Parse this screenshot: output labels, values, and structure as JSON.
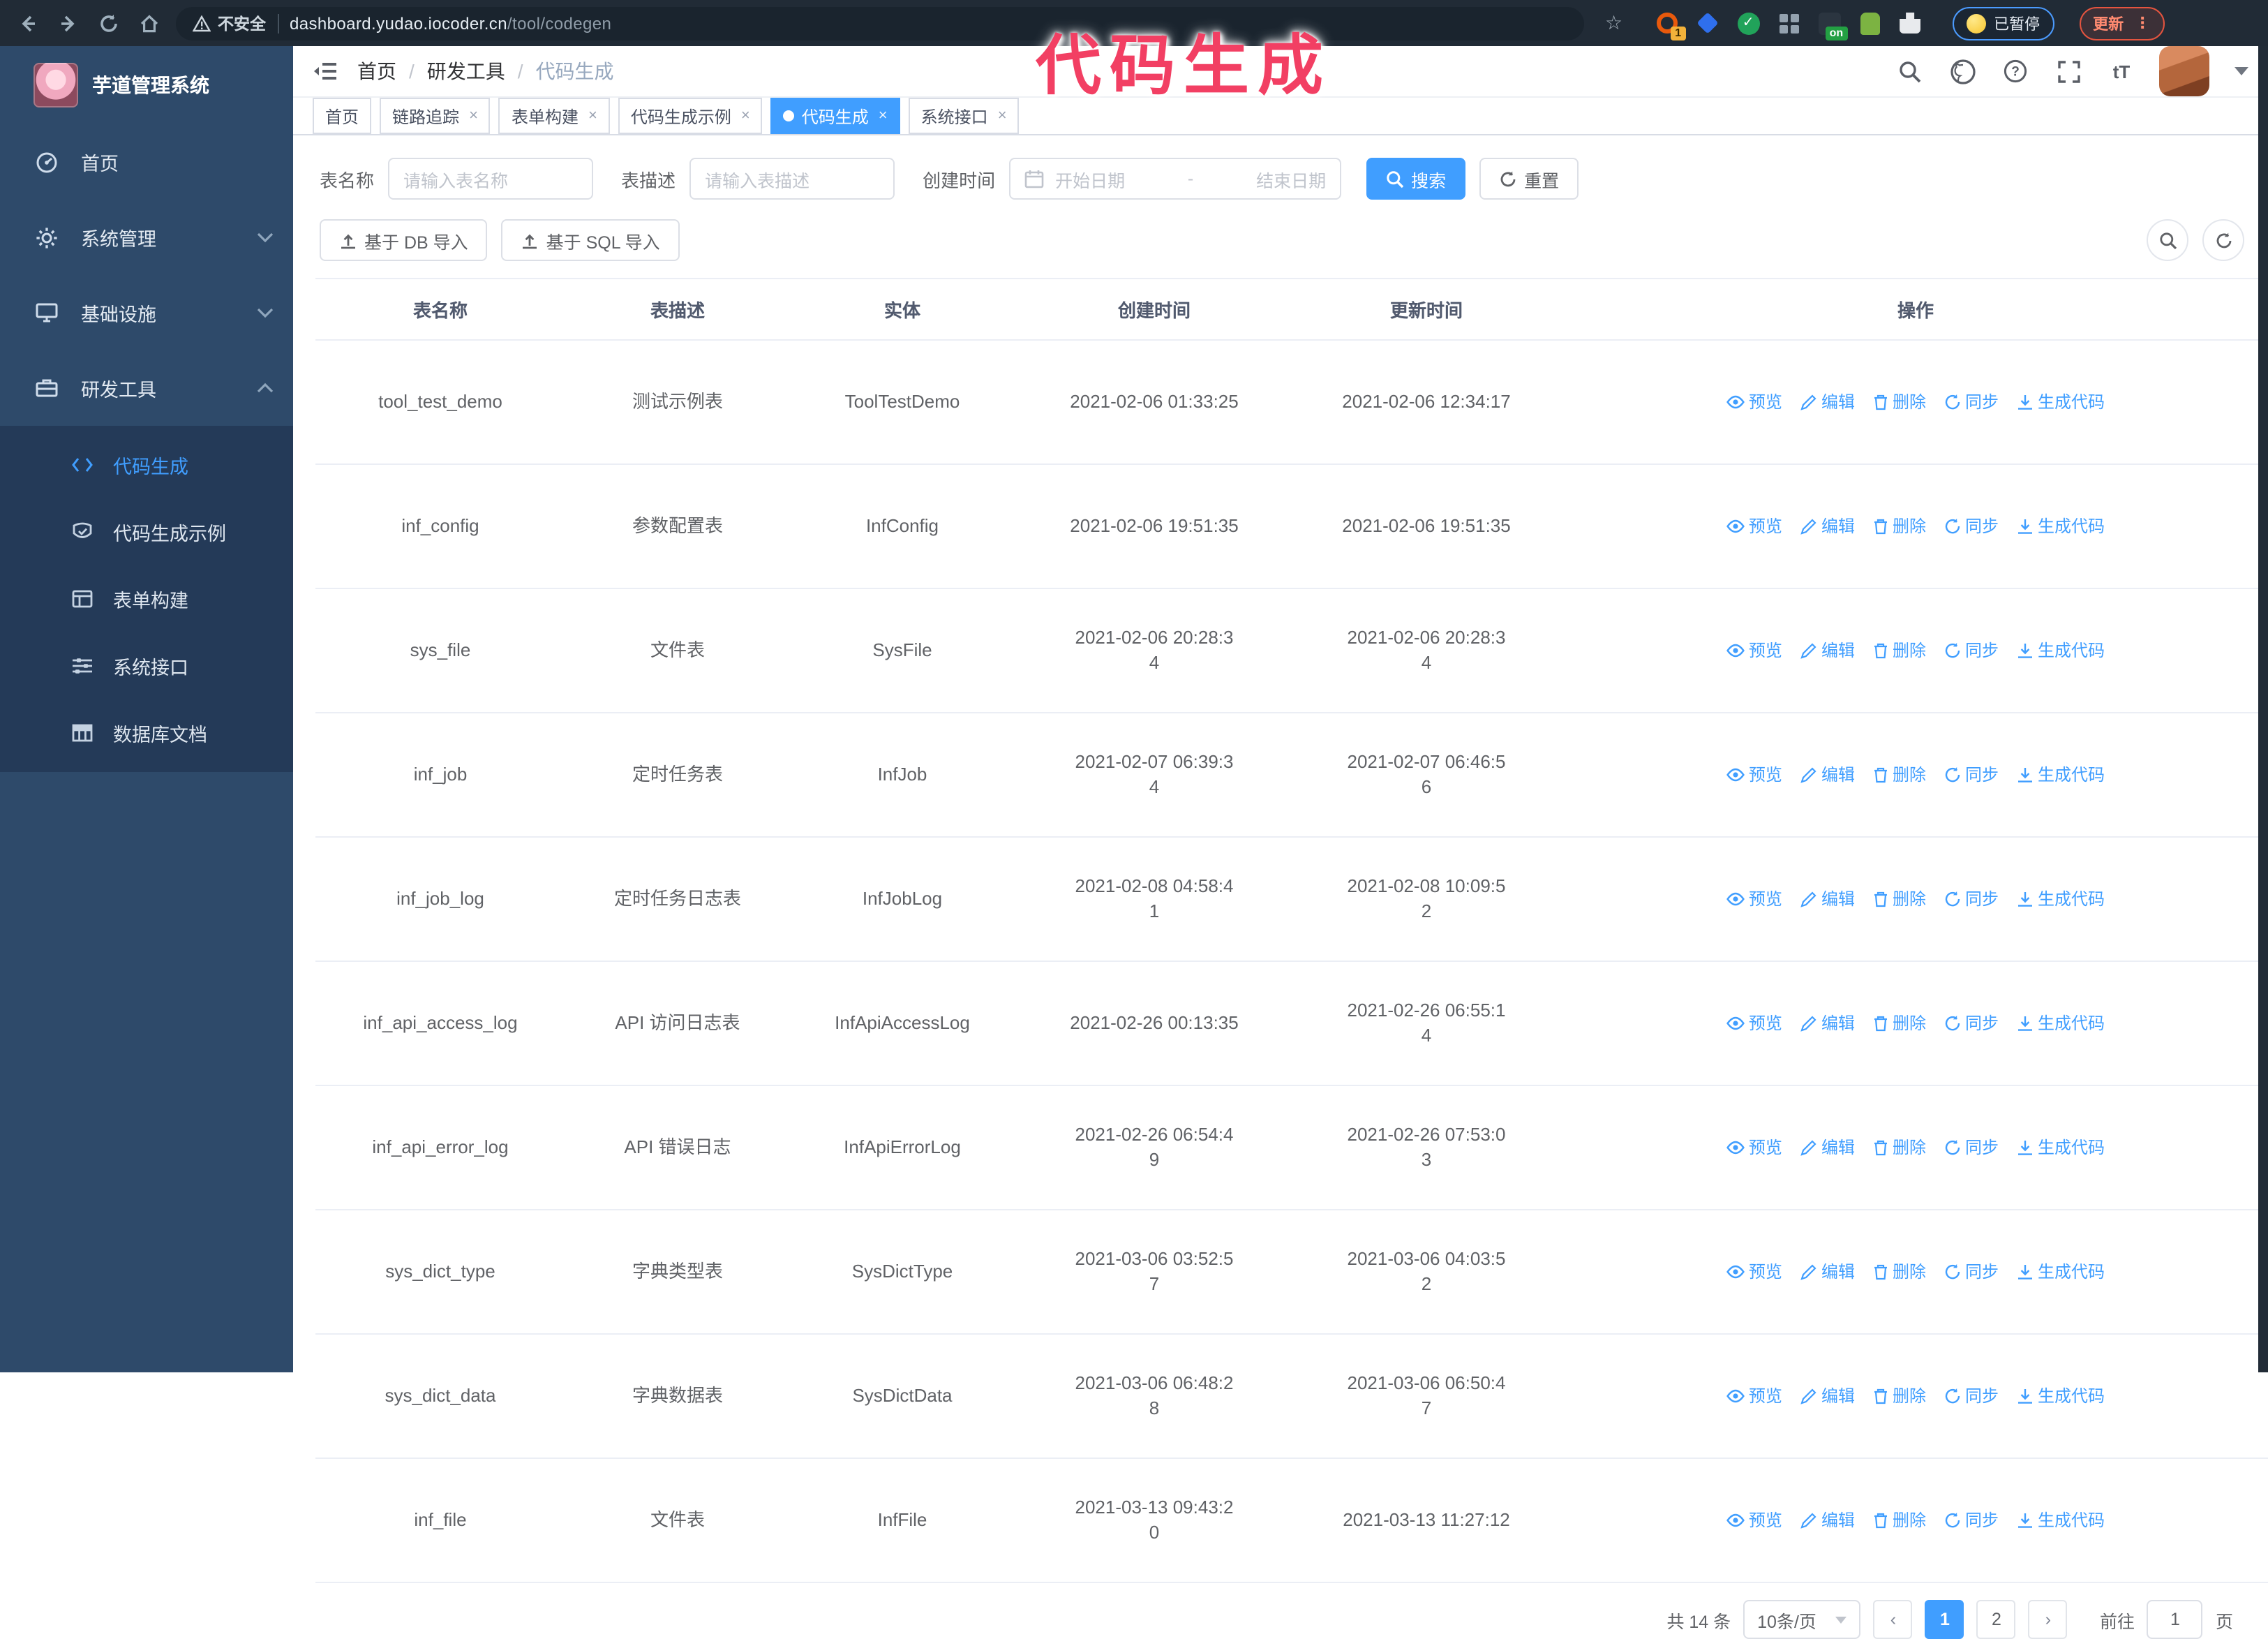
{
  "browser": {
    "security_warning": "不安全",
    "url_host": "dashboard.yudao.iocoder.cn",
    "url_path": "/tool/codegen",
    "extension_badge": "1",
    "extension_on_badge": "on",
    "paused_badge": "已暂停",
    "update_button": "更新"
  },
  "annotation": {
    "text": "代码生成"
  },
  "sidebar": {
    "title": "芋道管理系统",
    "items": [
      {
        "label": "首页"
      },
      {
        "label": "系统管理"
      },
      {
        "label": "基础设施"
      },
      {
        "label": "研发工具"
      }
    ],
    "submenu": [
      {
        "label": "代码生成"
      },
      {
        "label": "代码生成示例"
      },
      {
        "label": "表单构建"
      },
      {
        "label": "系统接口"
      },
      {
        "label": "数据库文档"
      }
    ]
  },
  "navbar": {
    "breadcrumb": [
      "首页",
      "研发工具",
      "代码生成"
    ]
  },
  "tabs": [
    {
      "label": "首页"
    },
    {
      "label": "链路追踪"
    },
    {
      "label": "表单构建"
    },
    {
      "label": "代码生成示例"
    },
    {
      "label": "代码生成"
    },
    {
      "label": "系统接口"
    }
  ],
  "filters": {
    "table_name_label": "表名称",
    "table_name_placeholder": "请输入表名称",
    "table_desc_label": "表描述",
    "table_desc_placeholder": "请输入表描述",
    "create_time_label": "创建时间",
    "date_start_placeholder": "开始日期",
    "date_separator": "-",
    "date_end_placeholder": "结束日期",
    "search_label": "搜索",
    "reset_label": "重置"
  },
  "toolbar": {
    "import_db_label": "基于 DB 导入",
    "import_sql_label": "基于 SQL 导入"
  },
  "table": {
    "columns": [
      "表名称",
      "表描述",
      "实体",
      "创建时间",
      "更新时间",
      "操作"
    ],
    "row_actions": [
      "预览",
      "编辑",
      "删除",
      "同步",
      "生成代码"
    ],
    "rows": [
      {
        "name": "tool_test_demo",
        "desc": "测试示例表",
        "entity": "ToolTestDemo",
        "created": "2021-02-06 01:33:25",
        "updated": "2021-02-06 12:34:17"
      },
      {
        "name": "inf_config",
        "desc": "参数配置表",
        "entity": "InfConfig",
        "created": "2021-02-06 19:51:35",
        "updated": "2021-02-06 19:51:35"
      },
      {
        "name": "sys_file",
        "desc": "文件表",
        "entity": "SysFile",
        "created": "2021-02-06 20:28:3\n4",
        "updated": "2021-02-06 20:28:3\n4"
      },
      {
        "name": "inf_job",
        "desc": "定时任务表",
        "entity": "InfJob",
        "created": "2021-02-07 06:39:3\n4",
        "updated": "2021-02-07 06:46:5\n6"
      },
      {
        "name": "inf_job_log",
        "desc": "定时任务日志表",
        "entity": "InfJobLog",
        "created": "2021-02-08 04:58:4\n1",
        "updated": "2021-02-08 10:09:5\n2"
      },
      {
        "name": "inf_api_access_log",
        "desc": "API 访问日志表",
        "entity": "InfApiAccessLog",
        "created": "2021-02-26 00:13:35",
        "updated": "2021-02-26 06:55:1\n4"
      },
      {
        "name": "inf_api_error_log",
        "desc": "API 错误日志",
        "entity": "InfApiErrorLog",
        "created": "2021-02-26 06:54:4\n9",
        "updated": "2021-02-26 07:53:0\n3"
      },
      {
        "name": "sys_dict_type",
        "desc": "字典类型表",
        "entity": "SysDictType",
        "created": "2021-03-06 03:52:5\n7",
        "updated": "2021-03-06 04:03:5\n2"
      },
      {
        "name": "sys_dict_data",
        "desc": "字典数据表",
        "entity": "SysDictData",
        "created": "2021-03-06 06:48:2\n8",
        "updated": "2021-03-06 06:50:4\n7"
      },
      {
        "name": "inf_file",
        "desc": "文件表",
        "entity": "InfFile",
        "created": "2021-03-13 09:43:2\n0",
        "updated": "2021-03-13 11:27:12"
      }
    ]
  },
  "pagination": {
    "total": "共 14 条",
    "page_size": "10条/页",
    "pages": [
      "1",
      "2"
    ],
    "goto_label": "前往",
    "goto_value": "1",
    "goto_suffix": "页"
  },
  "colors": {
    "accent": "#409eff",
    "sidebar": "#2e4a6a",
    "submenu": "#243a58",
    "annotation": "#f23f63",
    "chrome": "#212b36"
  }
}
